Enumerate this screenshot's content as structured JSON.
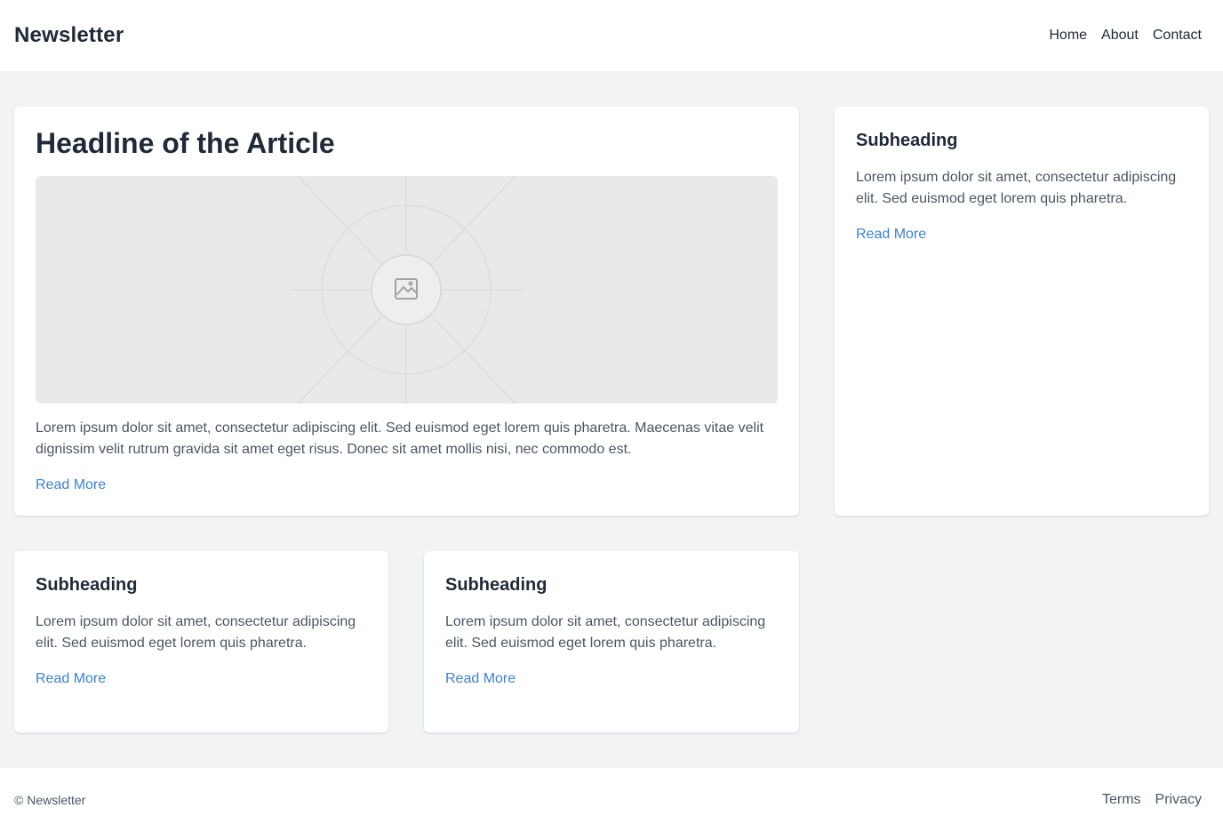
{
  "header": {
    "brand": "Newsletter",
    "nav": [
      {
        "label": "Home"
      },
      {
        "label": "About"
      },
      {
        "label": "Contact"
      }
    ]
  },
  "main_article": {
    "headline": "Headline of the Article",
    "image_icon": "image-icon",
    "body": "Lorem ipsum dolor sit amet, consectetur adipiscing elit. Sed euismod eget lorem quis pharetra. Maecenas vitae velit dignissim velit rutrum gravida sit amet eget risus. Donec sit amet mollis nisi, nec commodo est.",
    "link": "Read More"
  },
  "side_article": {
    "subheading": "Subheading",
    "body": "Lorem ipsum dolor sit amet, consectetur adipiscing elit. Sed euismod eget lorem quis pharetra.",
    "link": "Read More"
  },
  "bottom_articles": [
    {
      "subheading": "Subheading",
      "body": "Lorem ipsum dolor sit amet, consectetur adipiscing elit. Sed euismod eget lorem quis pharetra.",
      "link": "Read More"
    },
    {
      "subheading": "Subheading",
      "body": "Lorem ipsum dolor sit amet, consectetur adipiscing elit. Sed euismod eget lorem quis pharetra.",
      "link": "Read More"
    }
  ],
  "footer": {
    "copyright": "© Newsletter",
    "links": [
      {
        "label": "Terms"
      },
      {
        "label": "Privacy"
      }
    ]
  },
  "colors": {
    "background": "#f2f3f5",
    "card": "#ffffff",
    "link": "#3b82d6",
    "text": "#1f2937",
    "muted": "#4b5563"
  }
}
